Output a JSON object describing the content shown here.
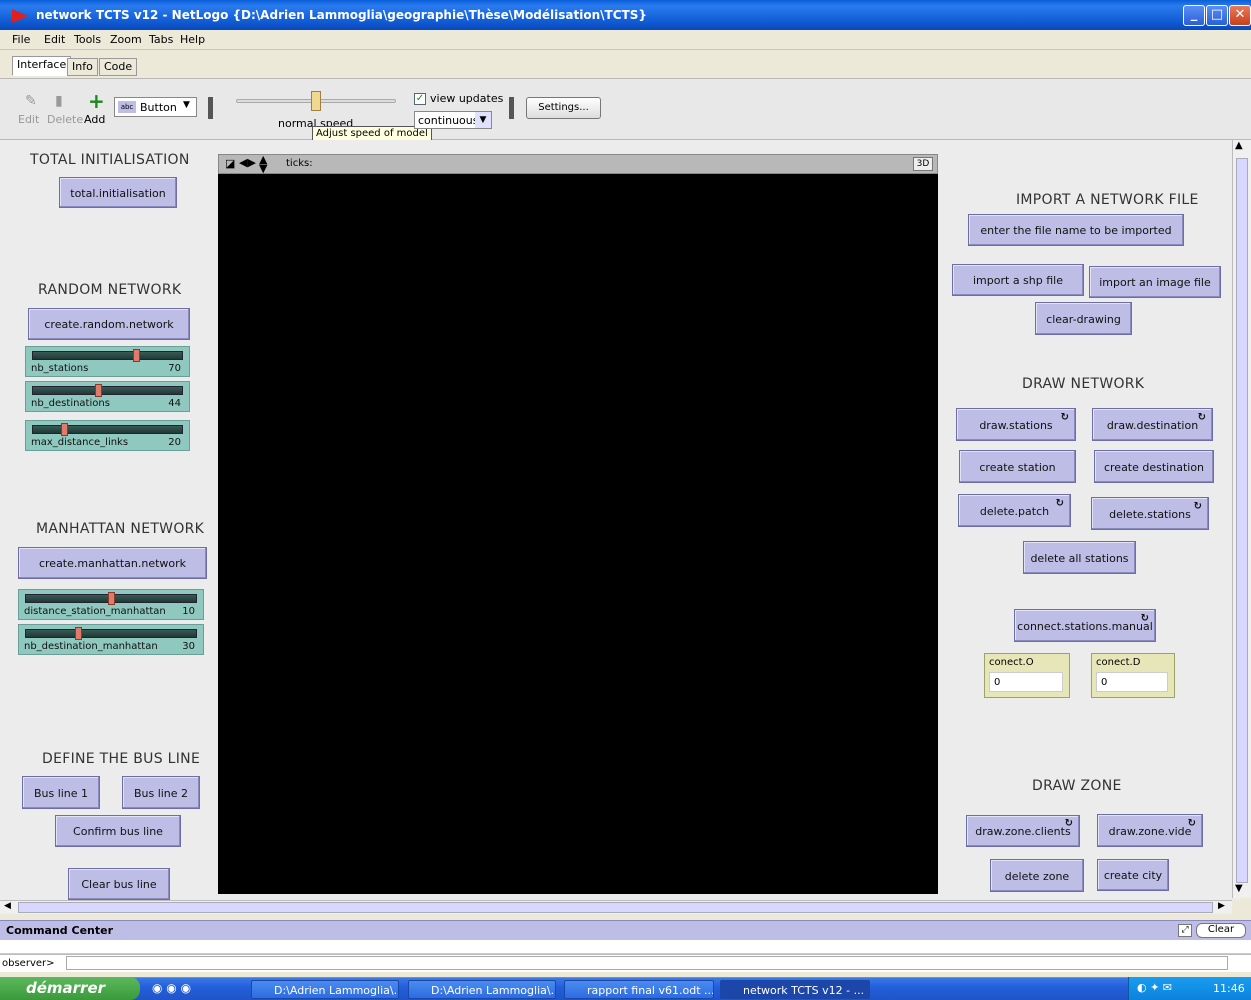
{
  "window": {
    "title": "network TCTS v12 - NetLogo {D:\\Adrien Lammoglia\\geographie\\Thèse\\Modélisation\\TCTS}"
  },
  "menu": [
    "File",
    "Edit",
    "Tools",
    "Zoom",
    "Tabs",
    "Help"
  ],
  "tabs": [
    "Interface",
    "Info",
    "Code"
  ],
  "toolbar": {
    "edit": "Edit",
    "delete": "Delete",
    "add": "Add",
    "widget_type": "Button",
    "speed_label": "normal speed",
    "speed_tooltip": "Adjust speed of model",
    "view_updates": "view updates",
    "update_mode": "continuous",
    "settings": "Settings..."
  },
  "view": {
    "ticks_label": "ticks:",
    "three_d": "3D"
  },
  "left": {
    "h_total": "TOTAL INITIALISATION",
    "b_total": "total.initialisation",
    "h_random": "RANDOM NETWORK",
    "b_random": "create.random.network",
    "sliders": [
      {
        "name": "nb_stations",
        "value": "70"
      },
      {
        "name": "nb_destinations",
        "value": "44"
      },
      {
        "name": "max_distance_links",
        "value": "20"
      }
    ],
    "h_manhattan": "MANHATTAN NETWORK",
    "b_manhattan": "create.manhattan.network",
    "sliders2": [
      {
        "name": "distance_station_manhattan",
        "value": "10"
      },
      {
        "name": "nb_destination_manhattan",
        "value": "30"
      }
    ],
    "h_bus": "DEFINE THE BUS LINE",
    "b_bus1": "Bus line 1",
    "b_bus2": "Bus line 2",
    "b_confirm": "Confirm bus line",
    "b_clear": "Clear bus line"
  },
  "right": {
    "h_import": "IMPORT A NETWORK FILE",
    "b_enter": "enter the file name to be imported",
    "b_shp": "import a shp file",
    "b_image": "import an image file",
    "b_cleardraw": "clear-drawing",
    "h_draw": "DRAW NETWORK",
    "b_drawstations": "draw.stations",
    "b_drawdest": "draw.destination",
    "b_createstation": "create station",
    "b_createdest": "create destination",
    "b_deletepatch": "delete.patch",
    "b_deletestations": "delete.stations",
    "b_deleteall": "delete all stations",
    "b_connect": "connect.stations.manual",
    "mon_o": {
      "label": "conect.O",
      "value": "0"
    },
    "mon_d": {
      "label": "conect.D",
      "value": "0"
    },
    "h_zone": "DRAW ZONE",
    "b_zoneclients": "draw.zone.clients",
    "b_zonevide": "draw.zone.vide",
    "b_deletezone": "delete zone",
    "b_createcity": "create city"
  },
  "command_center": {
    "title": "Command Center",
    "clear": "Clear",
    "prompt": "observer>"
  },
  "taskbar": {
    "start": "démarrer",
    "tasks": [
      "D:\\Adrien Lammoglia\\...",
      "D:\\Adrien Lammoglia\\...",
      "rapport final v61.odt ...",
      "network TCTS v12 - ..."
    ],
    "clock": "11:46"
  },
  "slider_positions": {
    "nb_stations": 0.7,
    "nb_destinations": 0.44,
    "max_distance_links": 0.2,
    "distance_station_manhattan": 0.5,
    "nb_destination_manhattan": 0.3
  }
}
